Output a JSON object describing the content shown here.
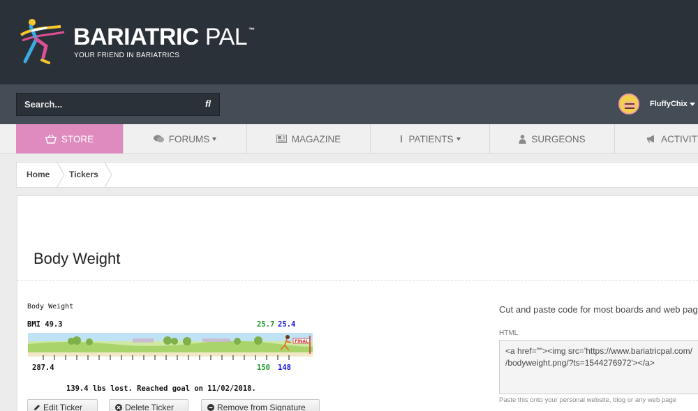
{
  "brand": {
    "name_bold": "BARIATRIC",
    "name_light": " PAL",
    "trademark": "™",
    "tagline": "YOUR FRIEND IN BARIATRICS",
    "logo_icon": "runner-logo-icon"
  },
  "search": {
    "placeholder": "Search...",
    "button_icon": "search-icon"
  },
  "user": {
    "name": "FluffyChix"
  },
  "nav": {
    "items": [
      {
        "label": "STORE",
        "icon": "basket-icon",
        "active": true
      },
      {
        "label": "FORUMS",
        "icon": "comments-icon",
        "dropdown": true
      },
      {
        "label": "MAGAZINE",
        "icon": "newspaper-icon"
      },
      {
        "label": "PATIENTS",
        "icon": "person-icon",
        "dropdown": true
      },
      {
        "label": "SURGEONS",
        "icon": "doctor-icon"
      },
      {
        "label": "ACTIVITY",
        "icon": "bullhorn-icon"
      }
    ],
    "active_color": "#e08bc0"
  },
  "breadcrumb": {
    "items": [
      "Home",
      "Tickers"
    ]
  },
  "page": {
    "title": "Body Weight"
  },
  "ticker": {
    "title": "Body Weight",
    "bmi_label": "BMI 49.3",
    "goal_bmi_1": "25.7",
    "goal_bmi_2": "25.4",
    "start_weight": "287.4",
    "goal_weight_1": "150",
    "goal_weight_2": "148",
    "finish_label": "FINAL",
    "summary": "139.4 lbs lost. Reached goal on 11/02/2018.",
    "colors": {
      "goal_1": "#1a9a2a",
      "goal_2": "#1414e0"
    }
  },
  "actions": {
    "edit": "Edit Ticker",
    "delete": "Delete Ticker",
    "remove": "Remove from Signature"
  },
  "code_panel": {
    "heading": "Cut and paste code for most boards and web pages",
    "html_label": "HTML",
    "code_line_1": "<a href=\"\"><img src='https://www.bariatricpal.com/",
    "code_line_2": "/bodyweight.png/?ts=1544276972'></a>",
    "hint": "Paste this onto your personal website, blog or any web page"
  }
}
